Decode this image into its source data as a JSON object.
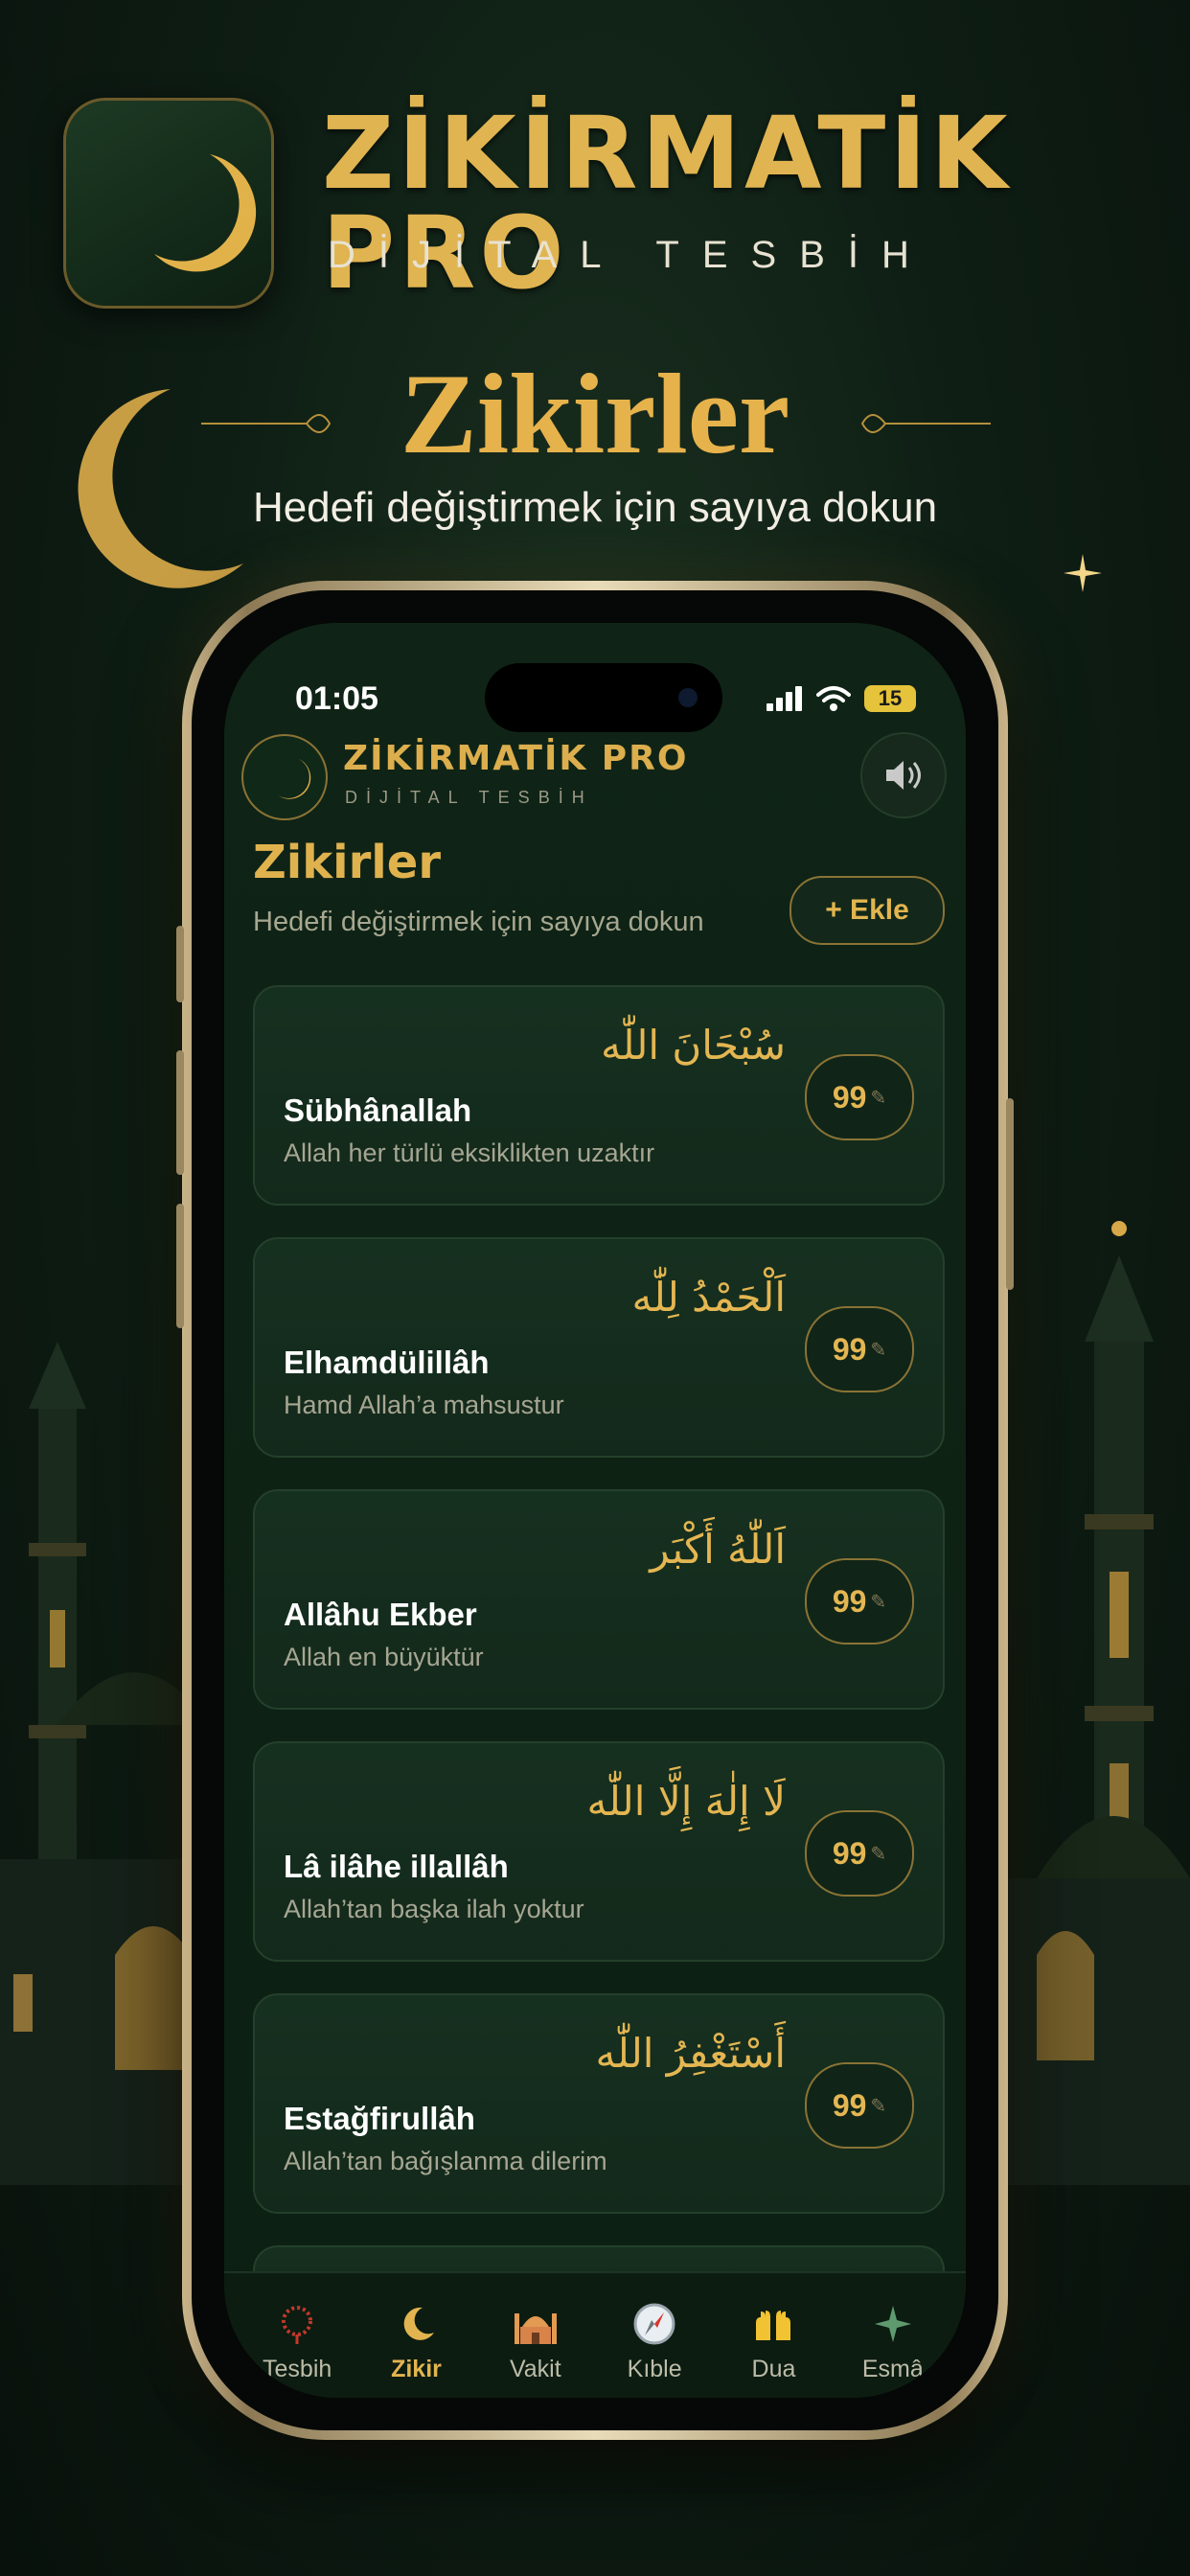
{
  "promo": {
    "brand_title": "ZİKİRMATİK PRO",
    "brand_subtitle": "DİJİTAL TESBİH",
    "headline": "Zikirler",
    "headline_sub": "Hedefi değiştirmek için sayıya dokun"
  },
  "status_bar": {
    "time": "01:05",
    "battery": "15"
  },
  "app_header": {
    "title": "ZİKİRMATİK PRO",
    "subtitle": "DİJİTAL TESBİH",
    "sound_icon": "speaker-icon"
  },
  "section": {
    "title": "Zikirler",
    "subtitle": "Hedefi değiştirmek için sayıya dokun",
    "add_label": "+ Ekle"
  },
  "zikirs": [
    {
      "arabic": "سُبْحَانَ اللّٰه",
      "name": "Sübhânallah",
      "meaning": "Allah her türlü eksiklikten uzaktır",
      "target": "99"
    },
    {
      "arabic": "اَلْحَمْدُ لِلّٰه",
      "name": "Elhamdülillâh",
      "meaning": "Hamd Allah’a mahsustur",
      "target": "99"
    },
    {
      "arabic": "اَللّٰهُ أَكْبَر",
      "name": "Allâhu Ekber",
      "meaning": "Allah en büyüktür",
      "target": "99"
    },
    {
      "arabic": "لَا إِلٰهَ إِلَّا اللّٰه",
      "name": "Lâ ilâhe illallâh",
      "meaning": "Allah’tan başka ilah yoktur",
      "target": "99"
    },
    {
      "arabic": "أَسْتَغْفِرُ اللّٰه",
      "name": "Estağfirullâh",
      "meaning": "Allah’tan bağışlanma dilerim",
      "target": "99"
    }
  ],
  "tabs": [
    {
      "label": "Tesbih",
      "icon": "tesbih-icon",
      "active": false
    },
    {
      "label": "Zikir",
      "icon": "crescent-icon",
      "active": true
    },
    {
      "label": "Vakit",
      "icon": "mosque-icon",
      "active": false
    },
    {
      "label": "Kıble",
      "icon": "compass-icon",
      "active": false
    },
    {
      "label": "Dua",
      "icon": "praying-hands-icon",
      "active": false
    },
    {
      "label": "Esmâ",
      "icon": "sparkle-icon",
      "active": false
    }
  ],
  "colors": {
    "gold": "#d9ad4a",
    "background": "#0f1f15",
    "card": "#163020"
  }
}
